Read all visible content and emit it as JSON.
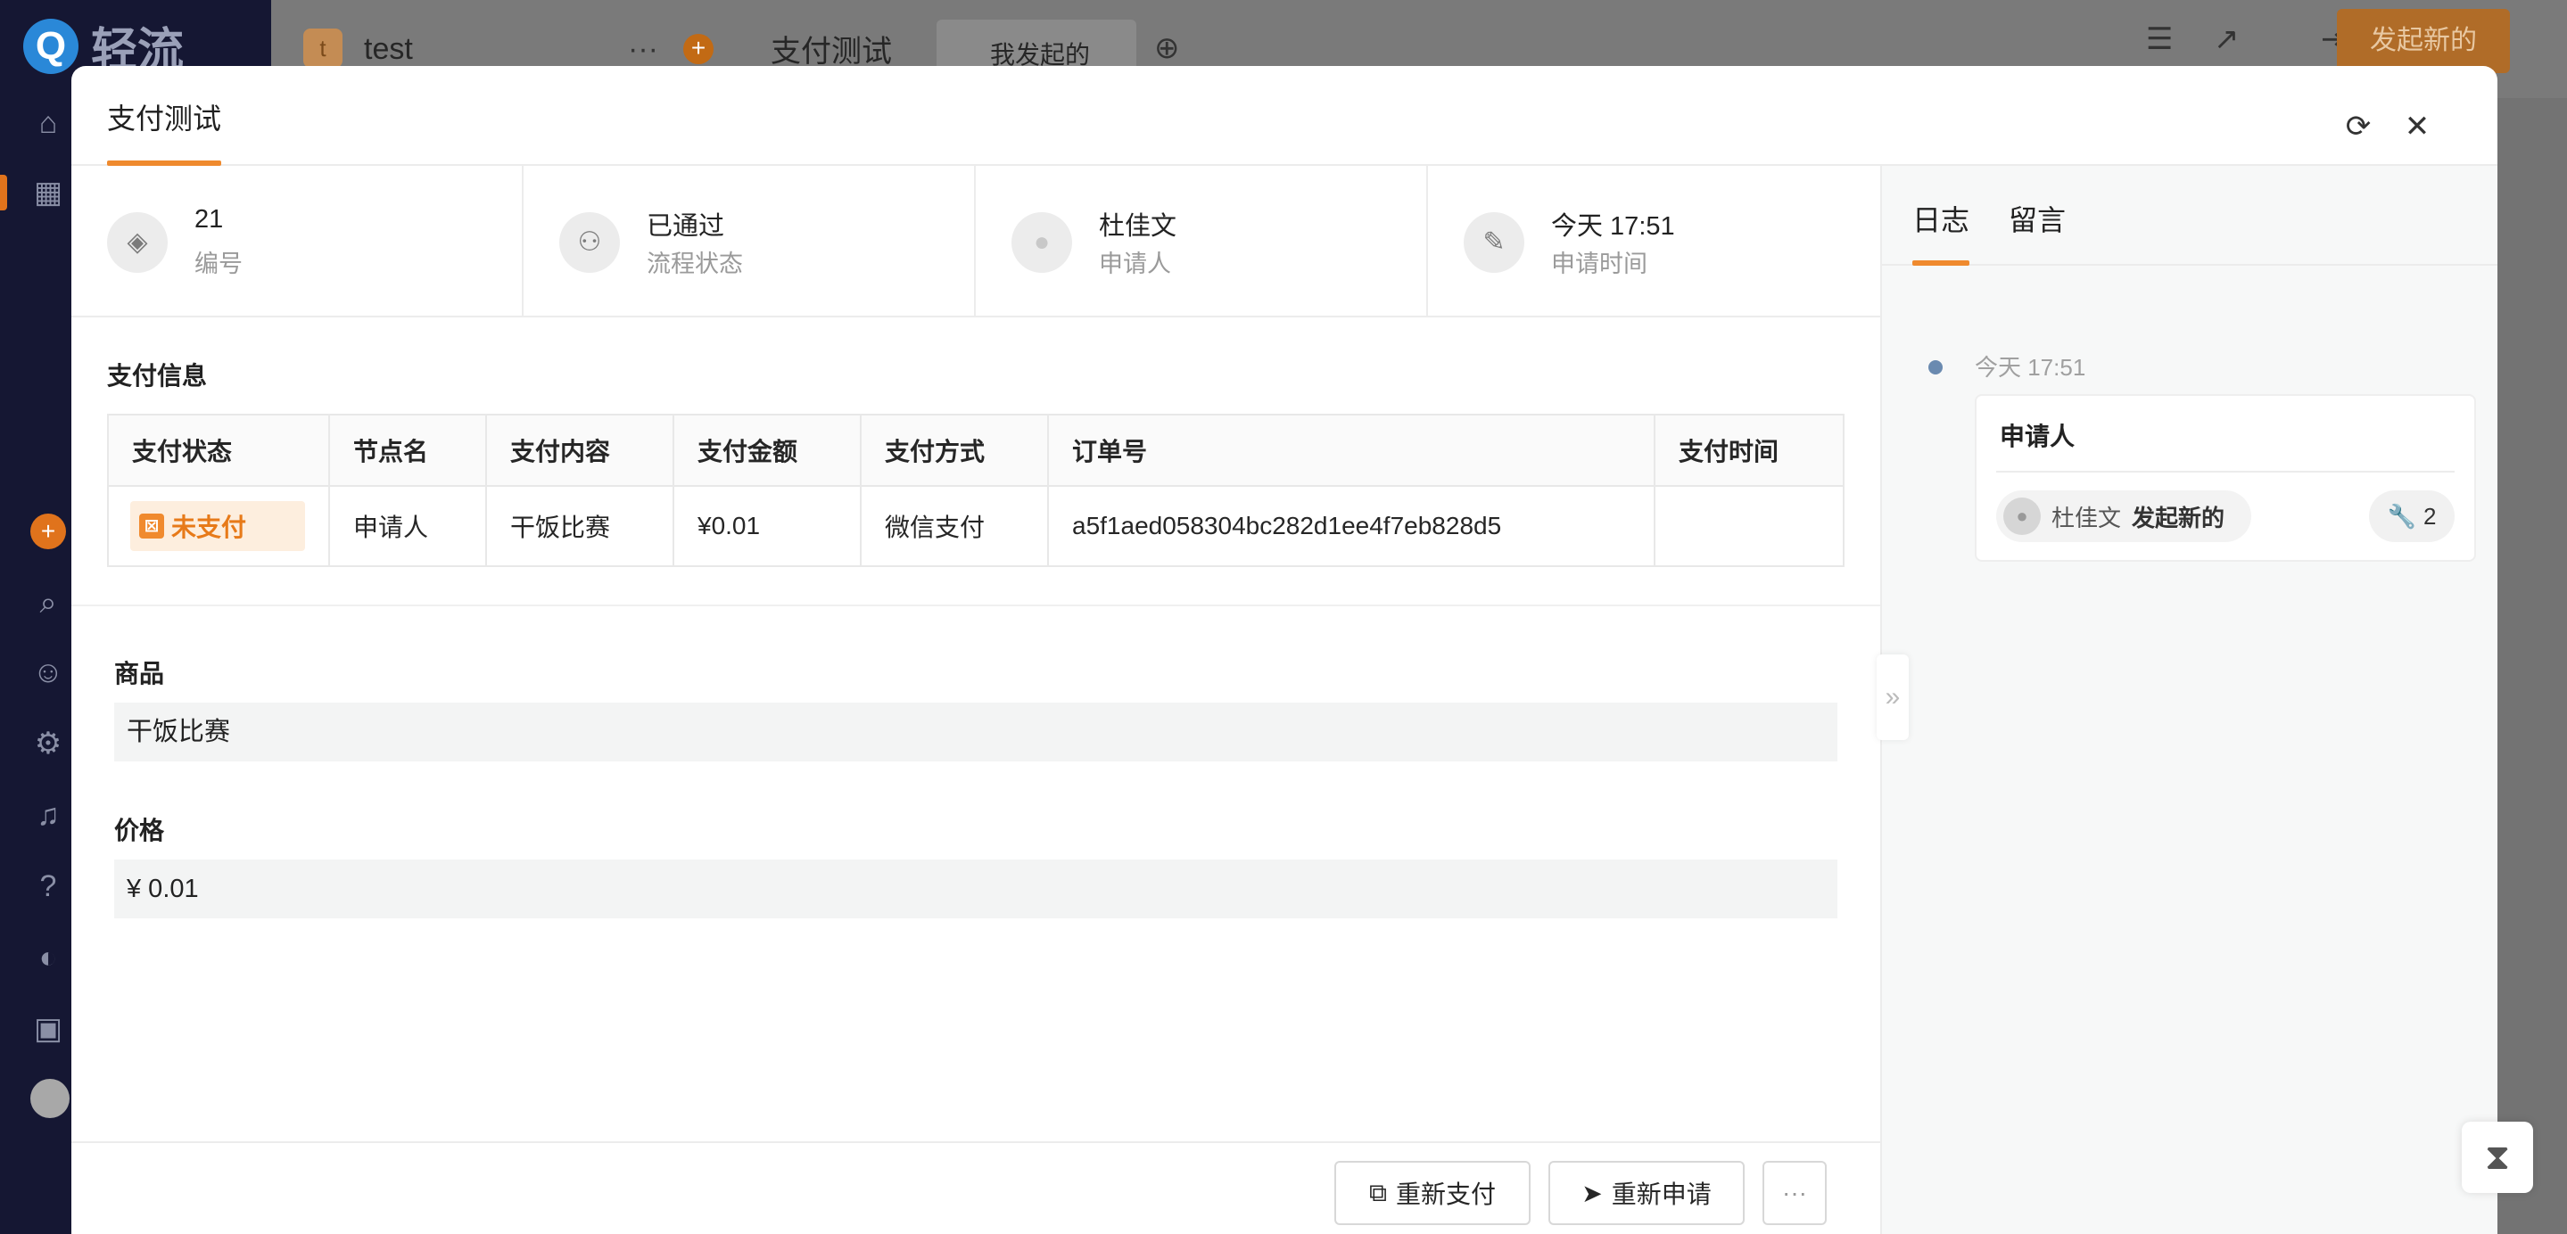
{
  "app": {
    "brand": "轻流",
    "workspace_badge": "t",
    "workspace_name": "test",
    "app_name": "支付测试",
    "view_name": "我发起的",
    "new_button": "发起新的"
  },
  "modal": {
    "title": "支付测试",
    "summary": [
      {
        "icon": "id-icon",
        "glyph": "◈",
        "value": "21",
        "label": "编号"
      },
      {
        "icon": "flow-icon",
        "glyph": "⚇",
        "value": "已通过",
        "label": "流程状态"
      },
      {
        "icon": "avatar-icon",
        "glyph": "●",
        "value": "杜佳文",
        "label": "申请人"
      },
      {
        "icon": "time-icon",
        "glyph": "✎",
        "value": "今天 17:51",
        "label": "申请时间"
      }
    ],
    "payment": {
      "title": "支付信息",
      "columns": [
        "支付状态",
        "节点名",
        "支付内容",
        "支付金额",
        "支付方式",
        "订单号",
        "支付时间"
      ],
      "row": {
        "status": "未支付",
        "node": "申请人",
        "content": "干饭比赛",
        "amount": "¥0.01",
        "method": "微信支付",
        "order_no": "a5f1aed058304bc282d1ee4f7eb828d5",
        "time": ""
      }
    },
    "fields": [
      {
        "label": "商品",
        "value": "干饭比赛"
      },
      {
        "label": "价格",
        "value": "¥ 0.01"
      }
    ],
    "footer": {
      "repay": "重新支付",
      "reapply": "重新申请",
      "more": "···"
    }
  },
  "log_panel": {
    "tabs": [
      "日志",
      "留言"
    ],
    "entries": [
      {
        "time": "今天 17:51",
        "node": "申请人",
        "user": "杜佳文",
        "action": "发起新的",
        "count": "2"
      }
    ]
  },
  "colors": {
    "accent": "#ef8a2e",
    "status_unpaid": "#e77a19"
  }
}
